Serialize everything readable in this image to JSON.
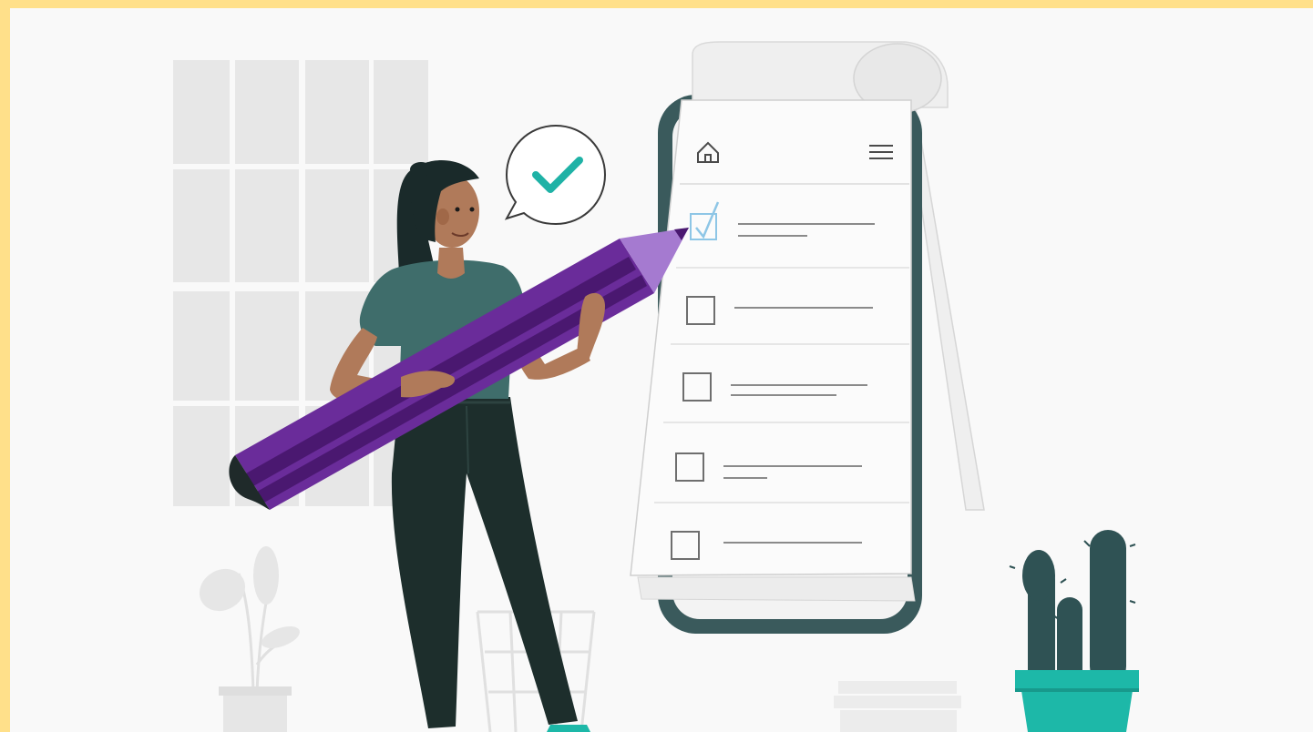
{
  "colors": {
    "frame_border": "#ffe08a",
    "background": "#f9f9f9",
    "decor_grey": "#e6e6e6",
    "phone_dark": "#3a5a5c",
    "shirt": "#3f6d6b",
    "pants": "#1d2e2c",
    "hair": "#1a2a2a",
    "skin": "#b07a5a",
    "pencil_purple": "#6a2c9a",
    "pencil_stripe": "#4a1870",
    "pencil_tip": "#a57ad0",
    "check_teal": "#1fb2a6",
    "cactus": "#2f5254",
    "pot_teal": "#1db8a8",
    "checked_box": "#8ec6e6"
  },
  "icons": {
    "home": "home-icon",
    "menu": "hamburger-menu-icon",
    "check": "checkmark-icon",
    "checkbox_checked": "checkbox-checked-icon",
    "checkbox_empty": "checkbox-empty-icon"
  },
  "checklist": {
    "items": [
      {
        "checked": true
      },
      {
        "checked": false
      },
      {
        "checked": false
      },
      {
        "checked": false
      },
      {
        "checked": false
      }
    ]
  }
}
